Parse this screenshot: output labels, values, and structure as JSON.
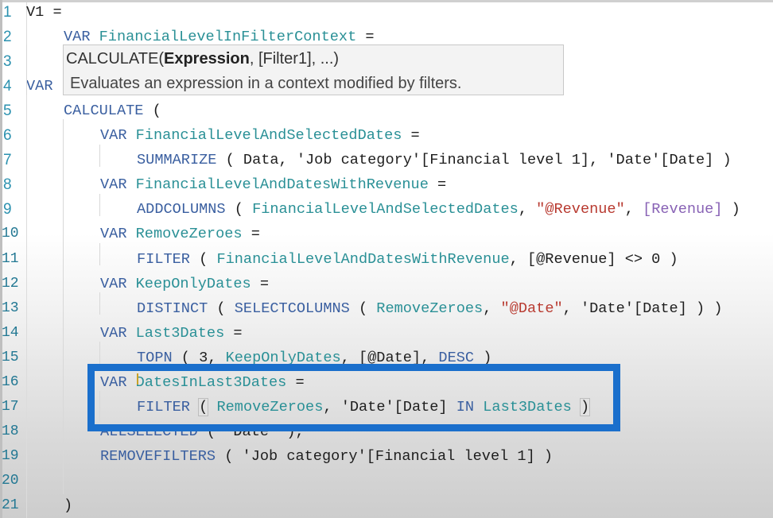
{
  "editor": {
    "lines": [
      {
        "n": "1",
        "tokens": [
          {
            "t": "V1 =",
            "c": "txt"
          }
        ]
      },
      {
        "n": "2",
        "tokens": [
          {
            "t": "VAR ",
            "c": "kw"
          },
          {
            "t": "FinancialLevelInFilterContext",
            "c": "var"
          },
          {
            "t": " =",
            "c": "txt"
          }
        ]
      },
      {
        "n": "3",
        "tokens": []
      },
      {
        "n": "4",
        "tokens": [
          {
            "t": "VAR",
            "c": "kw"
          }
        ]
      },
      {
        "n": "5",
        "tokens": [
          {
            "t": "CALCULATE",
            "c": "kw"
          },
          {
            "t": " (",
            "c": "txt"
          }
        ]
      },
      {
        "n": "6",
        "tokens": [
          {
            "t": "VAR ",
            "c": "kw"
          },
          {
            "t": "FinancialLevelAndSelectedDates",
            "c": "var"
          },
          {
            "t": " =",
            "c": "txt"
          }
        ]
      },
      {
        "n": "7",
        "tokens": [
          {
            "t": "SUMMARIZE",
            "c": "kw"
          },
          {
            "t": " ( Data, 'Job category'[Financial level 1], 'Date'[Date] )",
            "c": "txt"
          }
        ]
      },
      {
        "n": "8",
        "tokens": [
          {
            "t": "VAR ",
            "c": "kw"
          },
          {
            "t": "FinancialLevelAndDatesWithRevenue",
            "c": "var"
          },
          {
            "t": " =",
            "c": "txt"
          }
        ]
      },
      {
        "n": "9",
        "tokens": [
          {
            "t": "ADDCOLUMNS",
            "c": "kw"
          },
          {
            "t": " ( ",
            "c": "txt"
          },
          {
            "t": "FinancialLevelAndSelectedDates",
            "c": "var"
          },
          {
            "t": ", ",
            "c": "txt"
          },
          {
            "t": "\"@Revenue\"",
            "c": "str"
          },
          {
            "t": ", ",
            "c": "txt"
          },
          {
            "t": "[Revenue]",
            "c": "meas"
          },
          {
            "t": " )",
            "c": "txt"
          }
        ]
      },
      {
        "n": "10",
        "tokens": [
          {
            "t": "VAR ",
            "c": "kw"
          },
          {
            "t": "RemoveZeroes",
            "c": "var"
          },
          {
            "t": " =",
            "c": "txt"
          }
        ]
      },
      {
        "n": "11",
        "tokens": [
          {
            "t": "FILTER",
            "c": "kw"
          },
          {
            "t": " ( ",
            "c": "txt"
          },
          {
            "t": "FinancialLevelAndDatesWithRevenue",
            "c": "var"
          },
          {
            "t": ", [@Revenue] <> 0 )",
            "c": "txt"
          }
        ]
      },
      {
        "n": "12",
        "tokens": [
          {
            "t": "VAR ",
            "c": "kw"
          },
          {
            "t": "KeepOnlyDates",
            "c": "var"
          },
          {
            "t": " =",
            "c": "txt"
          }
        ]
      },
      {
        "n": "13",
        "tokens": [
          {
            "t": "DISTINCT",
            "c": "kw"
          },
          {
            "t": " ( ",
            "c": "txt"
          },
          {
            "t": "SELECTCOLUMNS",
            "c": "kw"
          },
          {
            "t": " ( ",
            "c": "txt"
          },
          {
            "t": "RemoveZeroes",
            "c": "var"
          },
          {
            "t": ", ",
            "c": "txt"
          },
          {
            "t": "\"@Date\"",
            "c": "str"
          },
          {
            "t": ", 'Date'[Date] ) )",
            "c": "txt"
          }
        ]
      },
      {
        "n": "14",
        "tokens": [
          {
            "t": "VAR ",
            "c": "kw"
          },
          {
            "t": "Last3Dates",
            "c": "var"
          },
          {
            "t": " =",
            "c": "txt"
          }
        ]
      },
      {
        "n": "15",
        "tokens": [
          {
            "t": "TOPN",
            "c": "kw"
          },
          {
            "t": " ( 3, ",
            "c": "txt"
          },
          {
            "t": "KeepOnlyDates",
            "c": "var"
          },
          {
            "t": ", [@Date], ",
            "c": "txt"
          },
          {
            "t": "DESC",
            "c": "kw"
          },
          {
            "t": " )",
            "c": "txt"
          }
        ]
      },
      {
        "n": "16",
        "tokens": [
          {
            "t": "VAR ",
            "c": "kw"
          },
          {
            "t": "DatesInLast3Dates",
            "c": "var"
          },
          {
            "t": " =",
            "c": "txt"
          }
        ]
      },
      {
        "n": "17",
        "tokens": [
          {
            "t": "FILTER",
            "c": "kw"
          },
          {
            "t": " ",
            "c": "txt"
          },
          {
            "t": "(",
            "c": "txt",
            "match": true
          },
          {
            "t": " ",
            "c": "txt"
          },
          {
            "t": "RemoveZeroes",
            "c": "var"
          },
          {
            "t": ", 'Date'[Date] ",
            "c": "txt"
          },
          {
            "t": "IN",
            "c": "kw"
          },
          {
            "t": " ",
            "c": "txt"
          },
          {
            "t": "Last3Dates",
            "c": "var"
          },
          {
            "t": " ",
            "c": "txt"
          },
          {
            "t": ")",
            "c": "txt",
            "match": true
          }
        ]
      },
      {
        "n": "18",
        "tokens": [
          {
            "t": "ALLSELECTED",
            "c": "kw"
          },
          {
            "t": " ( 'Date' ),",
            "c": "txt"
          }
        ]
      },
      {
        "n": "19",
        "tokens": [
          {
            "t": "REMOVEFILTERS",
            "c": "kw"
          },
          {
            "t": " ( 'Job category'[Financial level 1] )",
            "c": "txt"
          }
        ]
      },
      {
        "n": "20",
        "tokens": []
      },
      {
        "n": "21",
        "tokens": [
          {
            "t": ")",
            "c": "txt"
          }
        ]
      }
    ]
  },
  "tooltip": {
    "function_name": "CALCULATE(",
    "param_current": "Expression",
    "param_rest": ", [Filter1], ...)",
    "description": "Evaluates an expression in a context modified by filters."
  },
  "highlight": {
    "color": "#1a6fcc",
    "target_lines": [
      "16",
      "17"
    ]
  }
}
